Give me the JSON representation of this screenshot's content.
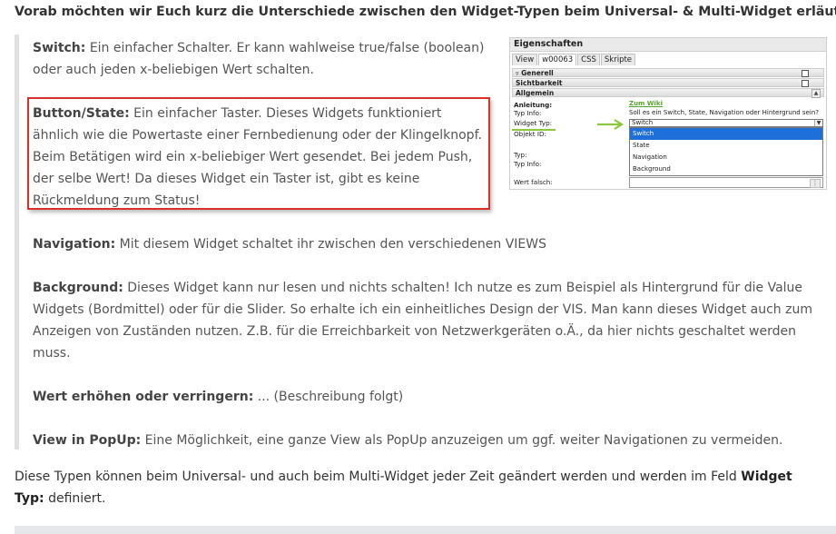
{
  "intro": "Vorab möchten wir Euch kurz die Unterschiede zwischen den Widget-Typen beim Universal- & Multi-Widget erläutern:",
  "items": [
    {
      "term": "Switch:",
      "text": " Ein einfacher Schalter. Er kann wahlweise true/false (boolean) oder auch jeden x-beliebigen Wert schalten."
    },
    {
      "term": "Button/State:",
      "text": " Ein einfacher Taster. Dieses Widgets funktioniert ähnlich wie die Powertaste einer Fernbedienung oder der Klingelknopf. Beim Betätigen wird ein x-beliebiger Wert gesendet. Bei jedem Push, der selbe Wert! Da dieses Widget ein Taster ist, gibt es keine Rückmeldung zum Status!"
    },
    {
      "term": "Navigation:",
      "text": " Mit diesem Widget schaltet ihr zwischen den verschiedenen VIEWS"
    },
    {
      "term": "Background:",
      "text": " Dieses Widget kann nur lesen und nichts schalten! Ich nutze es zum Beispiel als Hintergrund für die Value Widgets (Bordmittel) oder für die Slider. So erhalte ich ein einheitliches Design der VIS. Man kann dieses Widget auch zum Anzeigen von Zuständen nutzen. Z.B. für die Erreichbarkeit von Netzwerkgeräten o.Ä., da hier nichts geschaltet werden muss."
    },
    {
      "term": "Wert erhöhen oder verringern:",
      "text": " ... (Beschreibung folgt)"
    },
    {
      "term": "View in PopUp:",
      "text": " Eine Möglichkeit, eine ganze View als PopUp anzuzeigen um ggf. weiter Navigationen zu vermeiden."
    }
  ],
  "outro": {
    "before": "Diese Typen können beim Universal- und auch beim Multi-Widget jeder Zeit geändert werden und werden im Feld ",
    "bold": "Widget Typ:",
    "after": " definiert."
  },
  "panel": {
    "title": "Eigenschaften",
    "tabs": [
      "View",
      "w00063",
      "CSS",
      "Skripte"
    ],
    "sections": {
      "generell": "Generell",
      "sichtbarkeit": "Sichtbarkeit",
      "allgemein": "Allgemein"
    },
    "rows": {
      "anleitung_label": "Anleitung:",
      "anleitung_value": "Zum Wiki",
      "typ_info_label": "Typ Info:",
      "typ_info_value": "Soll es ein Switch, State, Navigation oder Hintergrund sein?",
      "widget_typ_label": "Widget Typ:",
      "objekt_id_label": "Objekt ID:",
      "typ_label": "Typ:",
      "typ_info2_label": "Typ Info:",
      "wert_falsch_label": "Wert falsch:"
    },
    "select_value": "Switch",
    "options": [
      "Switch",
      "State",
      "Navigation",
      "Background"
    ],
    "accent_color": "#8dc63f",
    "highlight_color": "#d9302a"
  }
}
